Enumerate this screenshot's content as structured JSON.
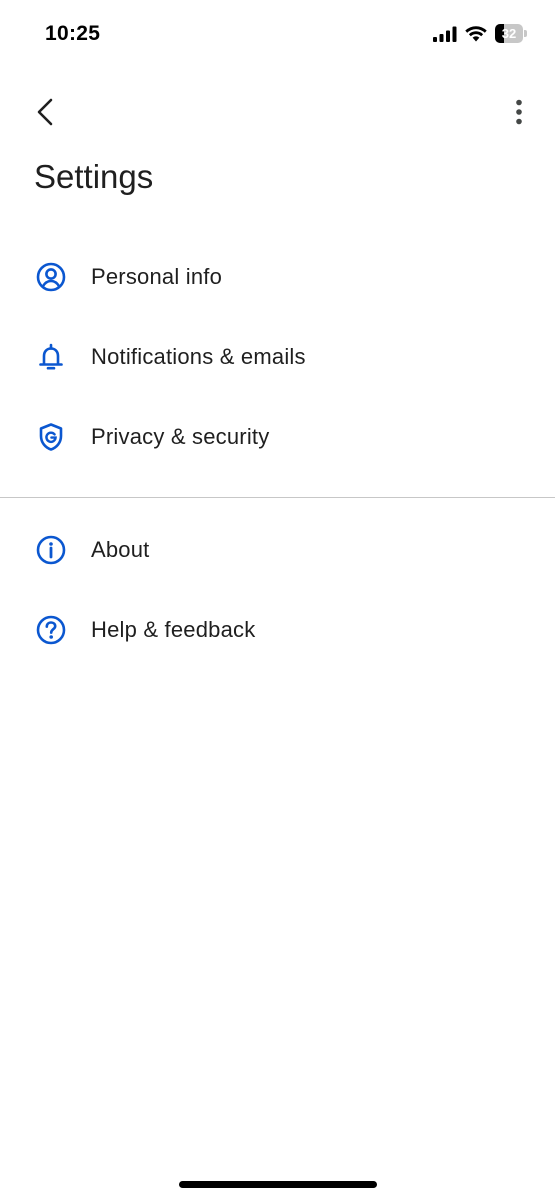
{
  "status_bar": {
    "time": "10:25",
    "battery_level": "32"
  },
  "header": {
    "title": "Settings"
  },
  "colors": {
    "accent": "#0b57d0",
    "text": "#1f1f1f",
    "divider": "#c7c7c7"
  },
  "settings": {
    "group1": [
      {
        "label": "Personal info",
        "icon": "account-circle-icon"
      },
      {
        "label": "Notifications & emails",
        "icon": "bell-icon"
      },
      {
        "label": "Privacy & security",
        "icon": "shield-g-icon"
      }
    ],
    "group2": [
      {
        "label": "About",
        "icon": "info-icon"
      },
      {
        "label": "Help & feedback",
        "icon": "help-icon"
      }
    ]
  }
}
